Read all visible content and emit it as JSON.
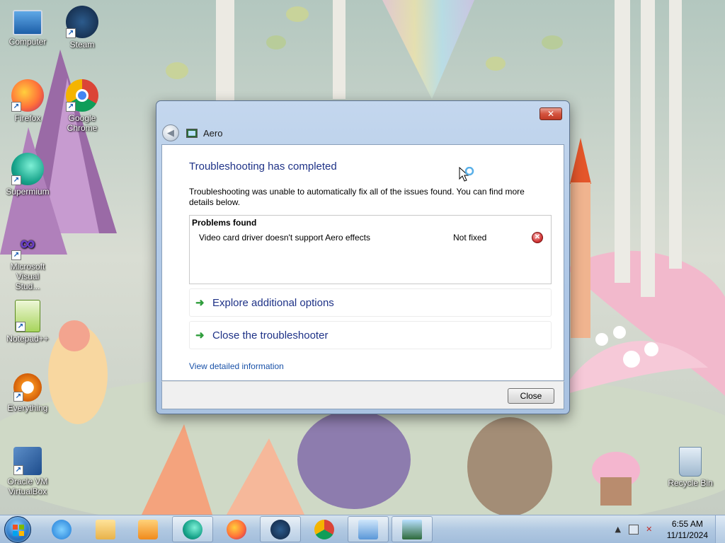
{
  "desktop": {
    "icons": [
      {
        "label": "Computer"
      },
      {
        "label": "Steam"
      },
      {
        "label": "Firefox"
      },
      {
        "label": "Google Chrome"
      },
      {
        "label": "Supermium"
      },
      {
        "label": "Microsoft Visual Stud..."
      },
      {
        "label": "Notepad++"
      },
      {
        "label": "Everything"
      },
      {
        "label": "Oracle VM VirtualBox"
      },
      {
        "label": "Recycle Bin"
      }
    ]
  },
  "dialog": {
    "app_title": "Aero",
    "close_glyph": "✕",
    "back_glyph": "◀",
    "heading": "Troubleshooting has completed",
    "description": "Troubleshooting was unable to automatically fix all of the issues found. You can find more details below.",
    "problems": {
      "header": "Problems found",
      "items": [
        {
          "name": "Video card driver doesn't support Aero effects",
          "status": "Not fixed",
          "status_icon": "error-icon"
        }
      ]
    },
    "options": [
      {
        "label": "Explore additional options",
        "icon": "green-arrow-icon"
      },
      {
        "label": "Close the troubleshooter",
        "icon": "green-arrow-icon"
      }
    ],
    "detail_link": "View detailed information",
    "close_button": "Close"
  },
  "taskbar": {
    "clock_time": "6:55 AM",
    "clock_date": "11/11/2024",
    "tray_up_arrow": "▲",
    "buttons": [
      {
        "name": "internet-explorer"
      },
      {
        "name": "file-explorer"
      },
      {
        "name": "media-player"
      },
      {
        "name": "supermium"
      },
      {
        "name": "firefox"
      },
      {
        "name": "steam"
      },
      {
        "name": "chrome"
      },
      {
        "name": "control-panel"
      },
      {
        "name": "aero-troubleshooter"
      }
    ]
  },
  "colors": {
    "heading_blue": "#1e3287",
    "link_blue": "#1a52a8",
    "arrow_green": "#2f9d3c",
    "error_red": "#d43a3a"
  }
}
